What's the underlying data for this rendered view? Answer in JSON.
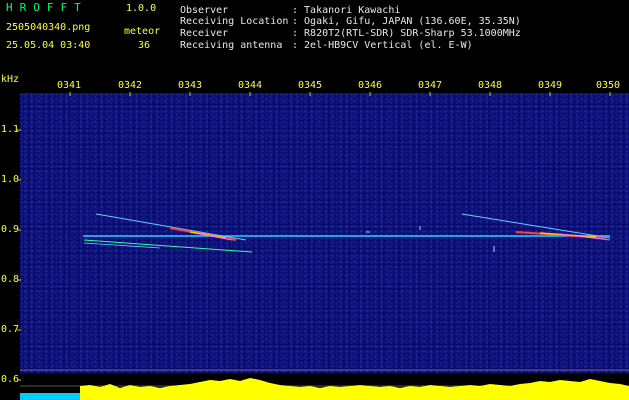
{
  "header": {
    "brand": "HROFFT",
    "version": "1.0.0",
    "filename": "2505040340.png",
    "datetime": "25.05.04 03:40",
    "meteor_label": "meteor",
    "meteor_count": "36",
    "info": [
      {
        "label": "Observer",
        "value": ": Takanori Kawachi"
      },
      {
        "label": "Receiving Location",
        "value": ": Ogaki, Gifu, JAPAN (136.60E, 35.35N)"
      },
      {
        "label": "Receiver",
        "value": ": R820T2(RTL-SDR) SDR-Sharp 53.1000MHz"
      },
      {
        "label": "Receiving antenna",
        "value": ": 2el-HB9CV Vertical (el. E-W)"
      }
    ]
  },
  "axis": {
    "unit": "kHz",
    "y_ticks": [
      "1.1",
      "1.0",
      "0.9",
      "0.8",
      "0.7",
      "0.6"
    ],
    "time_ticks": [
      "0341",
      "0342",
      "0343",
      "0344",
      "0345",
      "0346",
      "0347",
      "0348",
      "0349",
      "0350"
    ]
  },
  "colors": {
    "background": "#000000",
    "plot": "#0a0a6a",
    "label_green": "#00ff66",
    "label_yellow": "#ffff33",
    "signal_line": "#33ccff",
    "echo_warm": "#ff4040",
    "spectrum": "#ffff00",
    "baseline": "#00ccff"
  }
}
